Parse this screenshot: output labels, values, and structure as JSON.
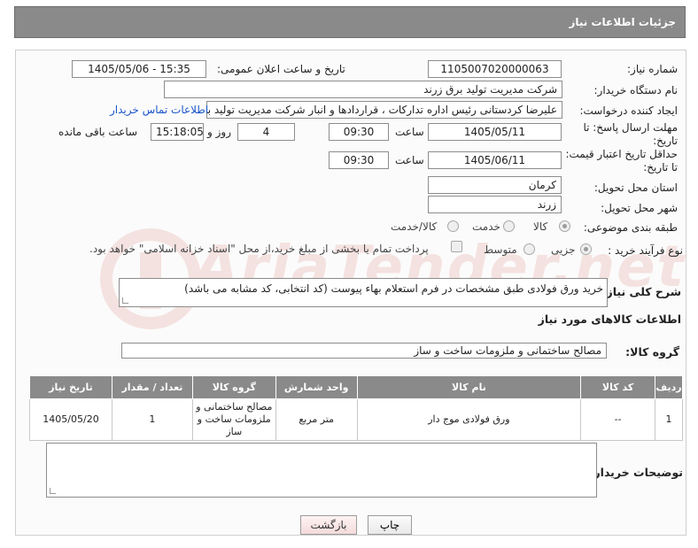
{
  "header": {
    "title": "جزئیات اطلاعات نیاز"
  },
  "form": {
    "need_number_label": "شماره نیاز:",
    "need_number": "1105007020000063",
    "announce_label": "تاریخ و ساعت اعلان عمومی:",
    "announce_value": "1405/05/06 - 15:35",
    "buyer_org_label": "نام دستگاه خریدار:",
    "buyer_org": "شرکت مدیریت تولید برق زرند",
    "creator_label": "ایجاد کننده درخواست:",
    "creator": "علیرضا کردستانی رئیس اداره تدارکات ، قراردادها و انبار  شرکت مدیریت تولید برق زرند",
    "contact_link": "اطلاعات تماس خریدار",
    "deadline_label_1": "مهلت ارسال پاسخ: تا",
    "deadline_label_2": "تاریخ:",
    "deadline_date": "1405/05/11",
    "time_label": "ساعت",
    "deadline_time": "09:30",
    "days_value": "4",
    "days_label": "روز و",
    "remaining_time": "15:18:05",
    "remaining_label": "ساعت باقی مانده",
    "validity_label_1": "حداقل تاریخ اعتبار قیمت:",
    "validity_label_2": "تا تاریخ:",
    "validity_date": "1405/06/11",
    "validity_time": "09:30",
    "province_label": "استان محل تحویل:",
    "province": "کرمان",
    "city_label": "شهر محل تحویل:",
    "city": "زرند",
    "category_label": "طبقه بندی موضوعی:",
    "category_options": [
      "کالا",
      "خدمت",
      "کالا/خدمت"
    ],
    "process_label": "نوع فرآیند خرید :",
    "process_options": [
      "جزیی",
      "متوسط"
    ],
    "payment_note": "پرداخت تمام یا بخشی از مبلغ خرید،از محل \"اسناد خزانه اسلامی\" خواهد بود.",
    "description_label": "شرح کلی نیاز:",
    "description": "خرید ورق فولادی طبق مشخصات در فرم استعلام بهاء پیوست (کد انتخابی، کد مشابه می باشد)",
    "items_title": "اطلاعات کالاهای مورد نیاز",
    "group_label": "گروه کالا:",
    "group_value": "مصالح ساختمانی و ملزومات ساخت و ساز",
    "buyer_notes_label": "توضیحات خریدار:",
    "buyer_notes": ""
  },
  "table": {
    "headers": [
      "ردیف",
      "کد کالا",
      "نام کالا",
      "واحد شمارش",
      "گروه کالا",
      "تعداد / مقدار",
      "تاریخ نیاز"
    ],
    "rows": [
      [
        "1",
        "--",
        "ورق فولادی موج دار",
        "متر مربع",
        "مصالح ساختمانی و ملزومات ساخت و ساز",
        "1",
        "1405/05/20"
      ]
    ]
  },
  "buttons": {
    "print": "چاپ",
    "back": "بازگشت"
  },
  "watermark": "AriaTender.net",
  "colors": {
    "header_bg": "#8a8a8a",
    "link": "#1a55c8",
    "watermark": "#cc4433"
  }
}
